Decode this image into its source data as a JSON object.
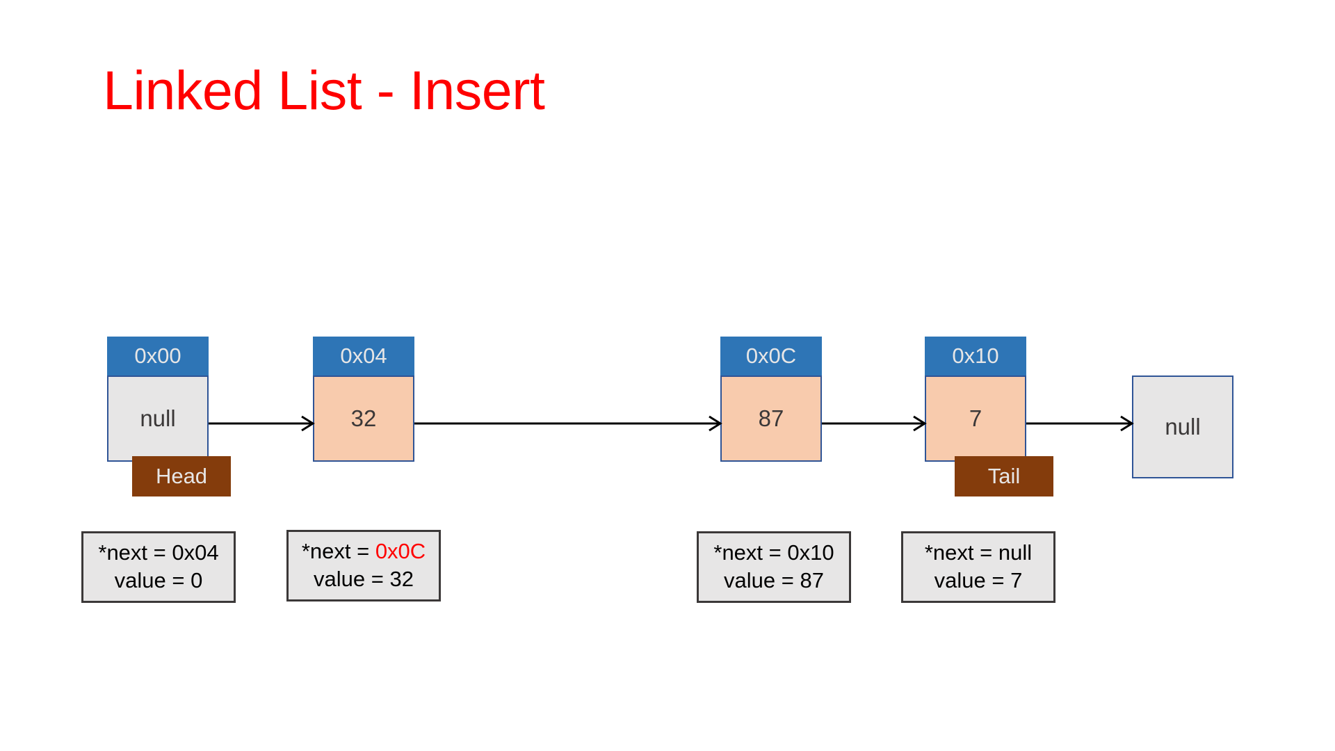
{
  "slide": {
    "title": "Linked List - Insert",
    "title_color": "#FF0000",
    "background": "#FFFFFF"
  },
  "colors": {
    "header_blue": "#2E75B6",
    "border_blue": "#2F5496",
    "body_gray": "#E7E6E6",
    "body_peach": "#F8CBAD",
    "badge_brown": "#843C0C",
    "accent_red": "#FF0000",
    "text_dark": "#3B3838"
  },
  "nodes": [
    {
      "address": "0x00",
      "value": "null",
      "fill": "gray",
      "badge": "Head"
    },
    {
      "address": "0x04",
      "value": "32",
      "fill": "peach",
      "badge": null
    },
    {
      "address": "0x0C",
      "value": "87",
      "fill": "peach",
      "badge": null
    },
    {
      "address": "0x10",
      "value": "7",
      "fill": "peach",
      "badge": "Tail"
    }
  ],
  "terminal": {
    "value": "null"
  },
  "badges": {
    "head": "Head",
    "tail": "Tail"
  },
  "info_boxes": [
    {
      "next_label": "*next = ",
      "next_value": "0x04",
      "next_highlight": false,
      "value_line": "value = 0"
    },
    {
      "next_label": "*next = ",
      "next_value": "0x0C",
      "next_highlight": true,
      "value_line": "value = 32"
    },
    {
      "next_label": "*next = ",
      "next_value": "0x10",
      "next_highlight": false,
      "value_line": "value = 87"
    },
    {
      "next_label": "*next = ",
      "next_value": "null",
      "next_highlight": false,
      "value_line": "value = 7"
    }
  ],
  "arrows": [
    {
      "from": "0x00",
      "to": "0x04"
    },
    {
      "from": "0x04",
      "to": "0x0C"
    },
    {
      "from": "0x0C",
      "to": "0x10"
    },
    {
      "from": "0x10",
      "to": "null"
    }
  ]
}
